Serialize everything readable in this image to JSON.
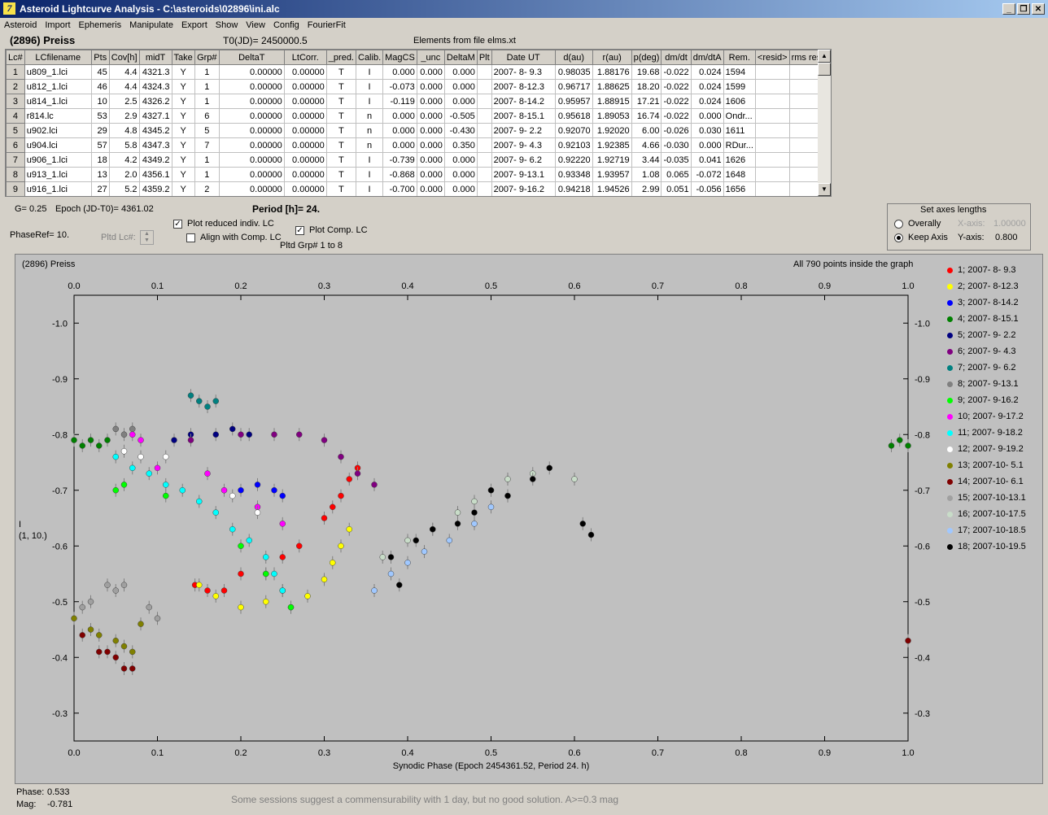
{
  "window": {
    "title": "Asteroid Lightcurve Analysis - C:\\asteroids\\02896\\ini.alc",
    "icon_letter": "7"
  },
  "menu": [
    "Asteroid",
    "Import",
    "Ephemeris",
    "Manipulate",
    "Export",
    "Show",
    "View",
    "Config",
    "FourierFit"
  ],
  "info": {
    "name": "(2896) Preiss",
    "t0": "T0(JD)= 2450000.5",
    "elements": "Elements from file elms.xt"
  },
  "table": {
    "columns": [
      "Lc#",
      "LCfilename",
      "Pts",
      "Cov[h]",
      "midT",
      "Take",
      "Grp#",
      "DeltaT",
      "LtCorr.",
      "_pred.",
      "Calib.",
      "MagCS",
      "_unc",
      "DeltaM",
      "Plt",
      "Date UT",
      "d(au)",
      "r(au)",
      "p(deg)",
      "dm/dt",
      "dm/dtA",
      "Rem.",
      "<resid>",
      "rms res"
    ],
    "rows": [
      [
        "1",
        "u809_1.lci",
        "45",
        "4.4",
        "4321.3",
        "Y",
        "1",
        "0.00000",
        "0.00000",
        "T",
        "I",
        "0.000",
        "0.000",
        "0.000",
        "",
        "2007- 8- 9.3",
        "0.98035",
        "1.88176",
        "19.68",
        "-0.022",
        "0.024",
        "1594",
        "",
        ""
      ],
      [
        "2",
        "u812_1.lci",
        "46",
        "4.4",
        "4324.3",
        "Y",
        "1",
        "0.00000",
        "0.00000",
        "T",
        "I",
        "-0.073",
        "0.000",
        "0.000",
        "",
        "2007- 8-12.3",
        "0.96717",
        "1.88625",
        "18.20",
        "-0.022",
        "0.024",
        "1599",
        "",
        ""
      ],
      [
        "3",
        "u814_1.lci",
        "10",
        "2.5",
        "4326.2",
        "Y",
        "1",
        "0.00000",
        "0.00000",
        "T",
        "I",
        "-0.119",
        "0.000",
        "0.000",
        "",
        "2007- 8-14.2",
        "0.95957",
        "1.88915",
        "17.21",
        "-0.022",
        "0.024",
        "1606",
        "",
        ""
      ],
      [
        "4",
        "r814.lc",
        "53",
        "2.9",
        "4327.1",
        "Y",
        "6",
        "0.00000",
        "0.00000",
        "T",
        "n",
        "0.000",
        "0.000",
        "-0.505",
        "",
        "2007- 8-15.1",
        "0.95618",
        "1.89053",
        "16.74",
        "-0.022",
        "0.000",
        "Ondr...",
        "",
        ""
      ],
      [
        "5",
        "u902.lci",
        "29",
        "4.8",
        "4345.2",
        "Y",
        "5",
        "0.00000",
        "0.00000",
        "T",
        "n",
        "0.000",
        "0.000",
        "-0.430",
        "",
        "2007- 9- 2.2",
        "0.92070",
        "1.92020",
        "6.00",
        "-0.026",
        "0.030",
        "1611",
        "",
        ""
      ],
      [
        "6",
        "u904.lci",
        "57",
        "5.8",
        "4347.3",
        "Y",
        "7",
        "0.00000",
        "0.00000",
        "T",
        "n",
        "0.000",
        "0.000",
        "0.350",
        "",
        "2007- 9- 4.3",
        "0.92103",
        "1.92385",
        "4.66",
        "-0.030",
        "0.000",
        "RDur...",
        "",
        ""
      ],
      [
        "7",
        "u906_1.lci",
        "18",
        "4.2",
        "4349.2",
        "Y",
        "1",
        "0.00000",
        "0.00000",
        "T",
        "I",
        "-0.739",
        "0.000",
        "0.000",
        "",
        "2007- 9- 6.2",
        "0.92220",
        "1.92719",
        "3.44",
        "-0.035",
        "0.041",
        "1626",
        "",
        ""
      ],
      [
        "8",
        "u913_1.lci",
        "13",
        "2.0",
        "4356.1",
        "Y",
        "1",
        "0.00000",
        "0.00000",
        "T",
        "I",
        "-0.868",
        "0.000",
        "0.000",
        "",
        "2007- 9-13.1",
        "0.93348",
        "1.93957",
        "1.08",
        "0.065",
        "-0.072",
        "1648",
        "",
        ""
      ],
      [
        "9",
        "u916_1.lci",
        "27",
        "5.2",
        "4359.2",
        "Y",
        "2",
        "0.00000",
        "0.00000",
        "T",
        "I",
        "-0.700",
        "0.000",
        "0.000",
        "",
        "2007- 9-16.2",
        "0.94218",
        "1.94526",
        "2.99",
        "0.051",
        "-0.056",
        "1656",
        "",
        ""
      ]
    ]
  },
  "params": {
    "g": "G= 0.25",
    "epoch": "Epoch (JD-T0)= 4361.02",
    "period": "Period [h]= 24.",
    "phaseref": "PhaseRef= 10.",
    "pltd_lc": "Pltd Lc#:",
    "plot_reduced": "Plot reduced indiv. LC",
    "align": "Align with Comp. LC",
    "plot_comp": "Plot Comp. LC",
    "pltd_grp": "Pltd Grp#  1   to   8"
  },
  "axes_box": {
    "title": "Set axes lengths",
    "overally": "Overally",
    "keep": "Keep Axis",
    "xaxis_label": "X-axis:",
    "xaxis_value": "1.00000",
    "yaxis_label": "Y-axis:",
    "yaxis_value": "0.800"
  },
  "plot_header": {
    "name": "(2896) Preiss",
    "points_note": "All 790 points inside the graph"
  },
  "chart_data": {
    "type": "scatter",
    "xlabel": "Synodic Phase (Epoch 2454361.52, Period 24. h)",
    "ylabel": "I",
    "ylabel2": "(1, 10.)",
    "xlim": [
      0,
      1
    ],
    "ylim": [
      -1.05,
      -0.25
    ],
    "y_inverted": true,
    "xticks": [
      "0.0",
      "0.1",
      "0.2",
      "0.3",
      "0.4",
      "0.5",
      "0.6",
      "0.7",
      "0.8",
      "0.9",
      "1.0"
    ],
    "yticks": [
      "-1.0",
      "-0.9",
      "-0.8",
      "-0.7",
      "-0.6",
      "-0.5",
      "-0.4",
      "-0.3"
    ],
    "series": [
      {
        "name": "1; 2007- 8- 9.3",
        "color": "#ff0000",
        "points": [
          [
            0.145,
            -0.53
          ],
          [
            0.16,
            -0.52
          ],
          [
            0.18,
            -0.52
          ],
          [
            0.2,
            -0.55
          ],
          [
            0.23,
            -0.55
          ],
          [
            0.25,
            -0.58
          ],
          [
            0.27,
            -0.6
          ],
          [
            0.3,
            -0.65
          ],
          [
            0.31,
            -0.67
          ],
          [
            0.32,
            -0.69
          ],
          [
            0.33,
            -0.72
          ],
          [
            0.34,
            -0.74
          ]
        ]
      },
      {
        "name": "2; 2007- 8-12.3",
        "color": "#ffff00",
        "points": [
          [
            0.15,
            -0.53
          ],
          [
            0.17,
            -0.51
          ],
          [
            0.2,
            -0.49
          ],
          [
            0.23,
            -0.5
          ],
          [
            0.26,
            -0.49
          ],
          [
            0.28,
            -0.51
          ],
          [
            0.3,
            -0.54
          ],
          [
            0.31,
            -0.57
          ],
          [
            0.32,
            -0.6
          ],
          [
            0.33,
            -0.63
          ]
        ]
      },
      {
        "name": "3; 2007- 8-14.2",
        "color": "#0000ff",
        "points": [
          [
            0.2,
            -0.7
          ],
          [
            0.22,
            -0.71
          ],
          [
            0.24,
            -0.7
          ],
          [
            0.25,
            -0.69
          ]
        ]
      },
      {
        "name": "4; 2007- 8-15.1",
        "color": "#008000",
        "points": [
          [
            0.0,
            -0.79
          ],
          [
            0.01,
            -0.78
          ],
          [
            0.02,
            -0.79
          ],
          [
            0.03,
            -0.78
          ],
          [
            0.04,
            -0.79
          ],
          [
            0.98,
            -0.78
          ],
          [
            0.99,
            -0.79
          ],
          [
            1.0,
            -0.78
          ]
        ]
      },
      {
        "name": "5; 2007- 9- 2.2",
        "color": "#000080",
        "points": [
          [
            0.12,
            -0.79
          ],
          [
            0.14,
            -0.8
          ],
          [
            0.17,
            -0.8
          ],
          [
            0.19,
            -0.81
          ],
          [
            0.21,
            -0.8
          ]
        ]
      },
      {
        "name": "6; 2007- 9- 4.3",
        "color": "#800080",
        "points": [
          [
            0.14,
            -0.79
          ],
          [
            0.2,
            -0.8
          ],
          [
            0.24,
            -0.8
          ],
          [
            0.27,
            -0.8
          ],
          [
            0.3,
            -0.79
          ],
          [
            0.32,
            -0.76
          ],
          [
            0.34,
            -0.73
          ],
          [
            0.36,
            -0.71
          ]
        ]
      },
      {
        "name": "7; 2007- 9- 6.2",
        "color": "#008080",
        "points": [
          [
            0.14,
            -0.87
          ],
          [
            0.15,
            -0.86
          ],
          [
            0.16,
            -0.85
          ],
          [
            0.17,
            -0.86
          ]
        ]
      },
      {
        "name": "8; 2007- 9-13.1",
        "color": "#808080",
        "points": [
          [
            0.05,
            -0.81
          ],
          [
            0.06,
            -0.8
          ],
          [
            0.07,
            -0.81
          ]
        ]
      },
      {
        "name": "9; 2007- 9-16.2",
        "color": "#00ff00",
        "points": [
          [
            0.05,
            -0.7
          ],
          [
            0.06,
            -0.71
          ],
          [
            0.11,
            -0.69
          ],
          [
            0.2,
            -0.6
          ],
          [
            0.23,
            -0.55
          ],
          [
            0.25,
            -0.52
          ],
          [
            0.26,
            -0.49
          ]
        ]
      },
      {
        "name": "10; 2007- 9-17.2",
        "color": "#ff00ff",
        "points": [
          [
            0.07,
            -0.8
          ],
          [
            0.08,
            -0.79
          ],
          [
            0.1,
            -0.74
          ],
          [
            0.16,
            -0.73
          ],
          [
            0.18,
            -0.7
          ],
          [
            0.22,
            -0.67
          ],
          [
            0.25,
            -0.64
          ]
        ]
      },
      {
        "name": "11; 2007- 9-18.2",
        "color": "#00ffff",
        "points": [
          [
            0.05,
            -0.76
          ],
          [
            0.07,
            -0.74
          ],
          [
            0.09,
            -0.73
          ],
          [
            0.11,
            -0.71
          ],
          [
            0.13,
            -0.7
          ],
          [
            0.15,
            -0.68
          ],
          [
            0.17,
            -0.66
          ],
          [
            0.19,
            -0.63
          ],
          [
            0.21,
            -0.61
          ],
          [
            0.23,
            -0.58
          ],
          [
            0.24,
            -0.55
          ],
          [
            0.25,
            -0.52
          ]
        ]
      },
      {
        "name": "12; 2007- 9-19.2",
        "color": "#ffffff",
        "points": [
          [
            0.06,
            -0.77
          ],
          [
            0.08,
            -0.76
          ],
          [
            0.11,
            -0.76
          ],
          [
            0.19,
            -0.69
          ],
          [
            0.22,
            -0.66
          ]
        ]
      },
      {
        "name": "13; 2007-10- 5.1",
        "color": "#808000",
        "points": [
          [
            0.0,
            -0.47
          ],
          [
            0.02,
            -0.45
          ],
          [
            0.03,
            -0.44
          ],
          [
            0.05,
            -0.43
          ],
          [
            0.06,
            -0.42
          ],
          [
            0.07,
            -0.41
          ],
          [
            0.08,
            -0.46
          ]
        ]
      },
      {
        "name": "14; 2007-10- 6.1",
        "color": "#800000",
        "points": [
          [
            0.01,
            -0.44
          ],
          [
            0.03,
            -0.41
          ],
          [
            0.04,
            -0.41
          ],
          [
            0.05,
            -0.4
          ],
          [
            0.06,
            -0.38
          ],
          [
            0.07,
            -0.38
          ],
          [
            1.0,
            -0.43
          ]
        ]
      },
      {
        "name": "15; 2007-10-13.1",
        "color": "#a0a0a0",
        "points": [
          [
            0.01,
            -0.49
          ],
          [
            0.02,
            -0.5
          ],
          [
            0.04,
            -0.53
          ],
          [
            0.05,
            -0.52
          ],
          [
            0.06,
            -0.53
          ],
          [
            0.09,
            -0.49
          ],
          [
            0.1,
            -0.47
          ]
        ]
      },
      {
        "name": "16; 2007-10-17.5",
        "color": "#c8dcc8",
        "points": [
          [
            0.37,
            -0.58
          ],
          [
            0.4,
            -0.61
          ],
          [
            0.43,
            -0.63
          ],
          [
            0.46,
            -0.66
          ],
          [
            0.48,
            -0.68
          ],
          [
            0.5,
            -0.7
          ],
          [
            0.52,
            -0.72
          ],
          [
            0.55,
            -0.73
          ],
          [
            0.6,
            -0.72
          ]
        ]
      },
      {
        "name": "17; 2007-10-18.5",
        "color": "#a0c8ff",
        "points": [
          [
            0.36,
            -0.52
          ],
          [
            0.38,
            -0.55
          ],
          [
            0.4,
            -0.57
          ],
          [
            0.42,
            -0.59
          ],
          [
            0.45,
            -0.61
          ],
          [
            0.48,
            -0.64
          ],
          [
            0.5,
            -0.67
          ],
          [
            0.52,
            -0.69
          ]
        ]
      },
      {
        "name": "18; 2007-10-19.5",
        "color": "#000000",
        "points": [
          [
            0.38,
            -0.58
          ],
          [
            0.39,
            -0.53
          ],
          [
            0.41,
            -0.61
          ],
          [
            0.43,
            -0.63
          ],
          [
            0.46,
            -0.64
          ],
          [
            0.48,
            -0.66
          ],
          [
            0.5,
            -0.7
          ],
          [
            0.52,
            -0.69
          ],
          [
            0.55,
            -0.72
          ],
          [
            0.57,
            -0.74
          ],
          [
            0.61,
            -0.64
          ],
          [
            0.62,
            -0.62
          ]
        ]
      }
    ]
  },
  "footer": {
    "phase_label": "Phase:",
    "phase_value": "0.533",
    "mag_label": "Mag:",
    "mag_value": "-0.781",
    "status": "Some sessions suggest a commensurability with 1 day, but no good solution.  A>=0.3 mag"
  }
}
